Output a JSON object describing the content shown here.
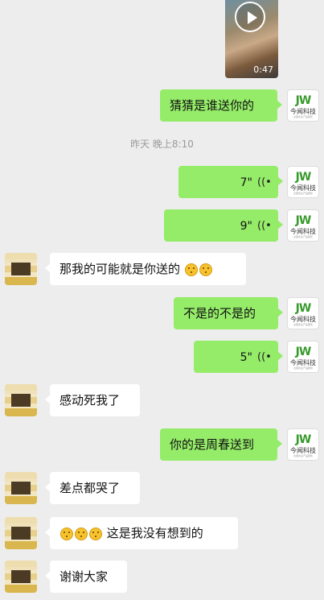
{
  "video": {
    "duration": "0:47",
    "play_icon": "play-icon"
  },
  "timestamp": "昨天 晚上8:10",
  "my_avatar": {
    "logo": "JW",
    "brand": "今闻科技",
    "tagline": "全国商业产品服务"
  },
  "messages": [
    {
      "side": "right",
      "type": "text",
      "text": "猜猜是谁送你的"
    },
    {
      "side": "right",
      "type": "voice",
      "duration": "7\"",
      "icon": "voice-wave-icon"
    },
    {
      "side": "right",
      "type": "voice",
      "duration": "9\"",
      "icon": "voice-wave-icon"
    },
    {
      "side": "left",
      "type": "text",
      "text": "那我的可能就是你送的",
      "emoji": "thinking-face-emoji"
    },
    {
      "side": "right",
      "type": "text",
      "text": "不是的不是的"
    },
    {
      "side": "right",
      "type": "voice",
      "duration": "5\"",
      "icon": "voice-wave-icon"
    },
    {
      "side": "left",
      "type": "text",
      "text": "感动死我了"
    },
    {
      "side": "right",
      "type": "text",
      "text": "你的是周春送到"
    },
    {
      "side": "left",
      "type": "text",
      "text": "差点都哭了"
    },
    {
      "side": "left",
      "type": "text",
      "text": "这是我没有想到的",
      "emoji": "thinking-face-emoji"
    },
    {
      "side": "left",
      "type": "text",
      "text": "谢谢大家"
    }
  ]
}
